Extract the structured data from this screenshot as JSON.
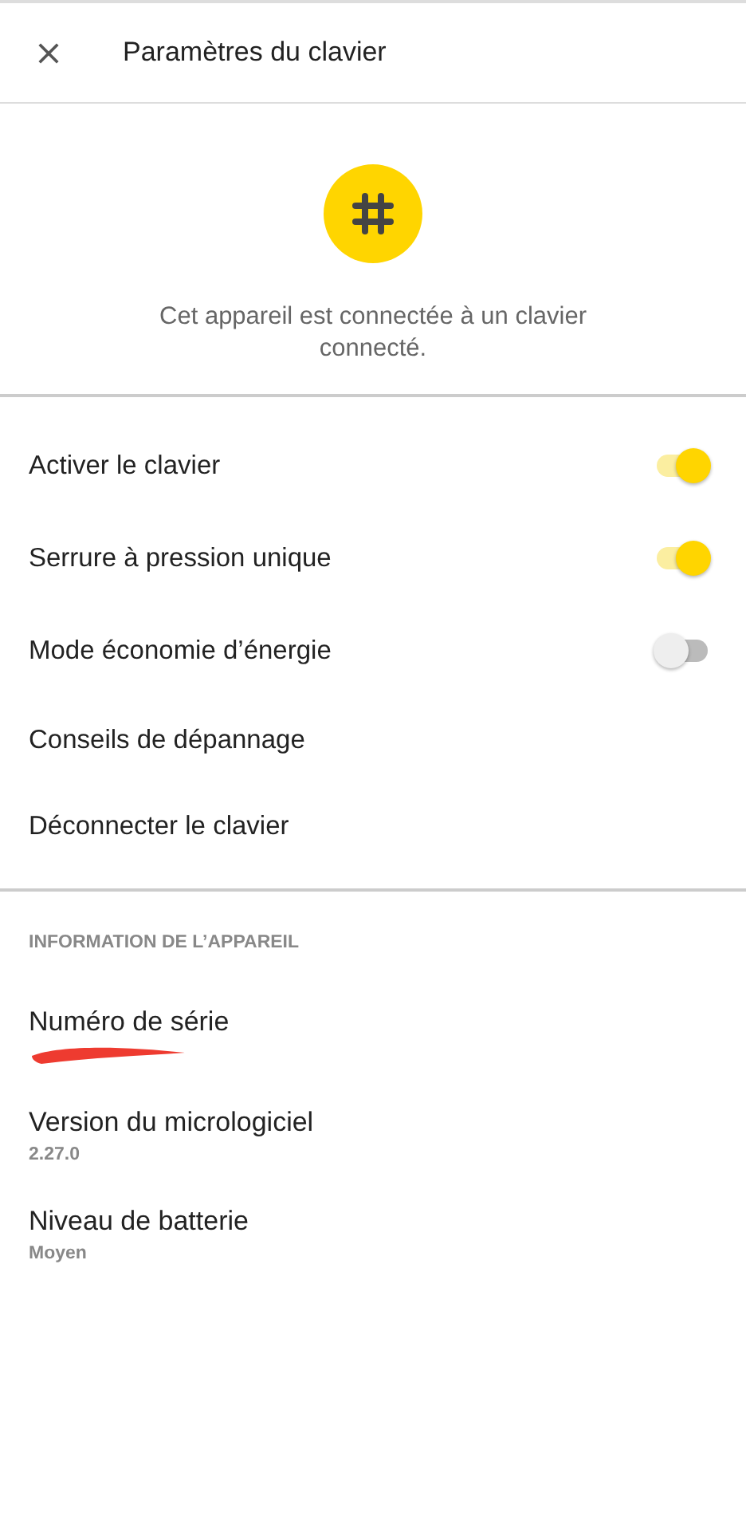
{
  "header": {
    "title": "Paramètres du clavier"
  },
  "device": {
    "message": "Cet appareil est connectée à un clavier connecté."
  },
  "settings": [
    {
      "kind": "toggle",
      "label": "Activer le clavier",
      "on": true
    },
    {
      "kind": "toggle",
      "label": "Serrure à pression unique",
      "on": true
    },
    {
      "kind": "toggle",
      "label": "Mode économie d’énergie",
      "on": false
    },
    {
      "kind": "link",
      "label": "Conseils de dépannage"
    },
    {
      "kind": "link",
      "label": "Déconnecter le clavier"
    }
  ],
  "info": {
    "heading": "INFORMATION DE L’APPAREIL",
    "items": [
      {
        "label": "Numéro de série",
        "redacted": true
      },
      {
        "label": "Version du micrologiciel",
        "value": "2.27.0",
        "redacted": false
      },
      {
        "label": "Niveau de batterie",
        "value": "Moyen",
        "redacted": false
      }
    ]
  }
}
